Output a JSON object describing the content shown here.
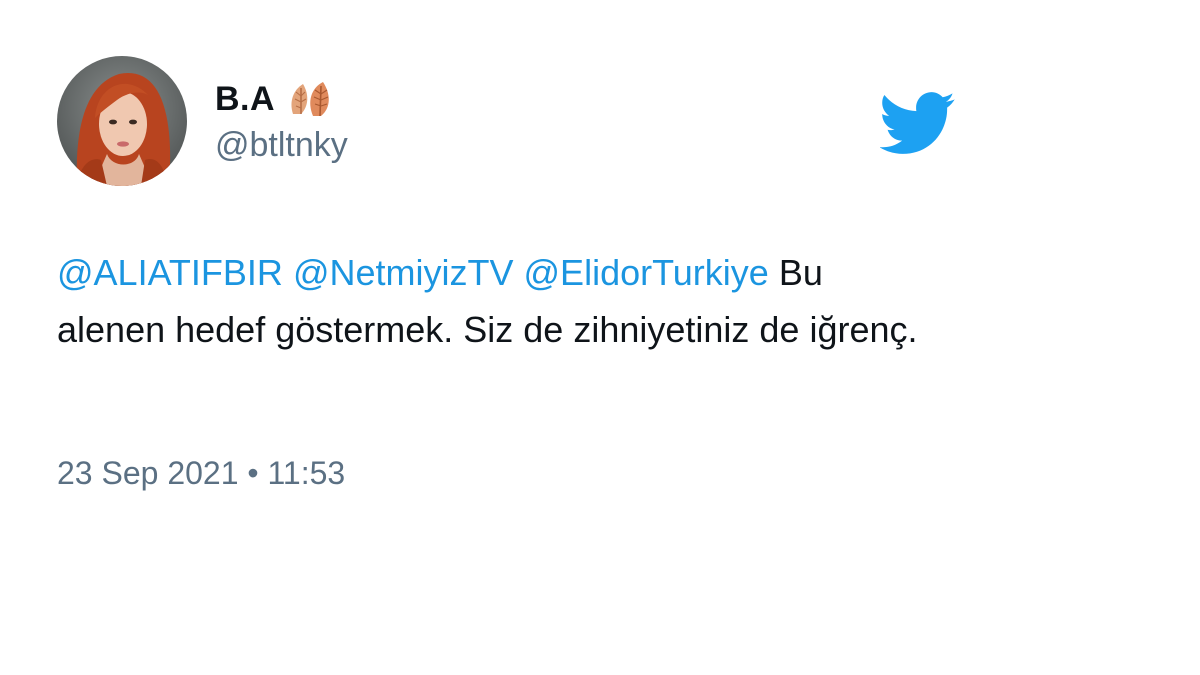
{
  "author": {
    "display_name": "B.A",
    "handle": "@btltnky",
    "name_emoji_icon": "leaves-icon"
  },
  "brand": {
    "logo_icon": "twitter-bird-icon",
    "accent_color": "#1DA1F2"
  },
  "tweet": {
    "mentions": [
      "@ALIATIFBIR",
      "@NetmiyizTV",
      "@ElidorTurkiye"
    ],
    "body_line1": "Bu",
    "body_rest": "alenen hedef göstermek. Siz de zihniyetiniz de iğrenç.",
    "timestamp": "23 Sep 2021 • 11:53"
  },
  "colors": {
    "mention": "#1b95e0",
    "text": "#0f1419",
    "secondary": "#5b7083"
  }
}
